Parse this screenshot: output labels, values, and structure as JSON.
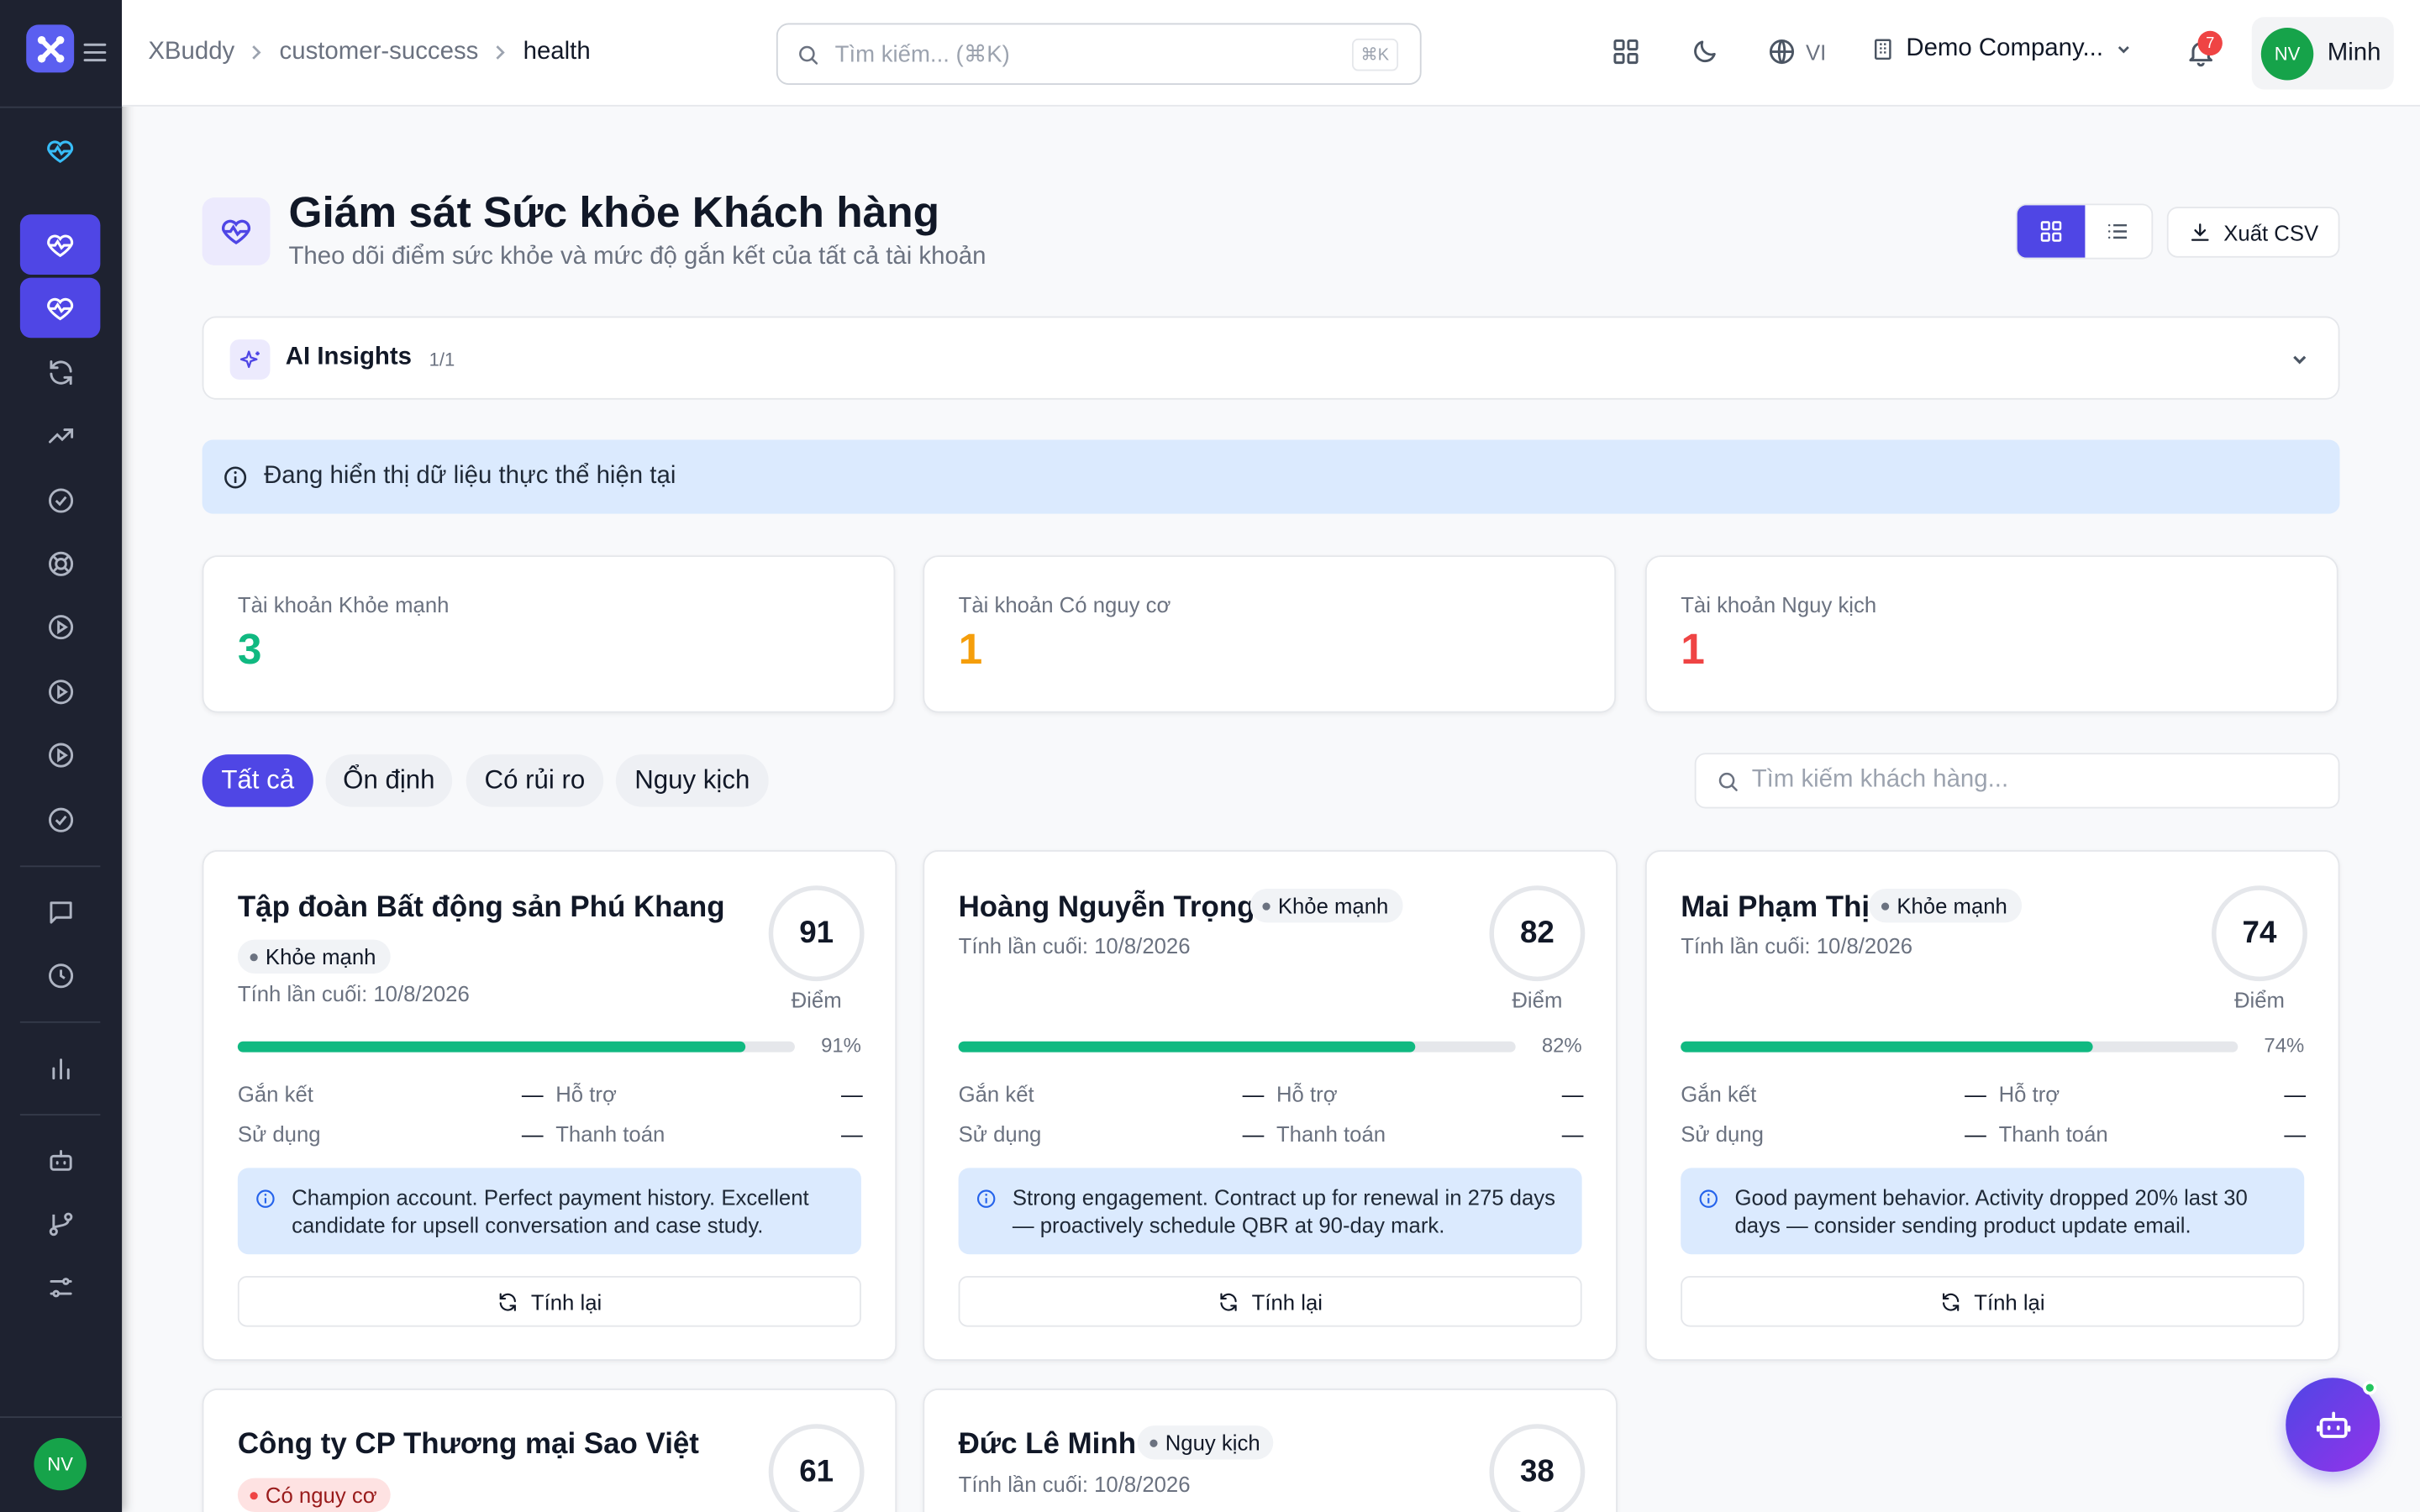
{
  "sidebar": {
    "avatar_initials": "NV"
  },
  "header": {
    "breadcrumb": [
      "XBuddy",
      "customer-success",
      "health"
    ],
    "search_placeholder": "Tìm kiếm... (⌘K)",
    "search_shortcut": "⌘K",
    "language": "VI",
    "company": "Demo Company...",
    "notification_count": "7",
    "user_initials": "NV",
    "user_name": "Minh"
  },
  "page": {
    "title": "Giám sát Sức khỏe Khách hàng",
    "subtitle": "Theo dõi điểm sức khỏe và mức độ gắn kết của tất cả tài khoản",
    "export_label": "Xuất CSV"
  },
  "insights": {
    "title": "AI Insights",
    "count": "1/1"
  },
  "info_banner": "Đang hiển thị dữ liệu thực thể hiện tại",
  "stats": [
    {
      "label": "Tài khoản Khỏe mạnh",
      "value": "3",
      "color": "#10b981"
    },
    {
      "label": "Tài khoản Có nguy cơ",
      "value": "1",
      "color": "#f59e0b"
    },
    {
      "label": "Tài khoản Nguy kịch",
      "value": "1",
      "color": "#ef4444"
    }
  ],
  "filters": {
    "tabs": [
      "Tất cả",
      "Ổn định",
      "Có rủi ro",
      "Nguy kịch"
    ],
    "active": "Tất cả",
    "search_placeholder": "Tìm kiếm khách hàng..."
  },
  "labels": {
    "score_unit": "Điểm",
    "engagement": "Gắn kết",
    "support": "Hỗ trợ",
    "usage": "Sử dụng",
    "payment": "Thanh toán",
    "empty": "—",
    "recalc": "Tính lại"
  },
  "customers": [
    {
      "name": "Tập đoàn Bất động sản Phú Khang",
      "status": "Khỏe mạnh",
      "computed": "Tính lần cuối: 10/8/2026",
      "score": "91",
      "progress": 0.91,
      "percent": "91%",
      "note": "Champion account. Perfect payment history. Excellent candidate for upsell conversation and case study."
    },
    {
      "name": "Hoàng Nguyễn Trọng",
      "status": "Khỏe mạnh",
      "computed": "Tính lần cuối: 10/8/2026",
      "score": "82",
      "progress": 0.82,
      "percent": "82%",
      "note": "Strong engagement. Contract up for renewal in 275 days — proactively schedule QBR at 90-day mark."
    },
    {
      "name": "Mai Phạm Thị",
      "status": "Khỏe mạnh",
      "computed": "Tính lần cuối: 10/8/2026",
      "score": "74",
      "progress": 0.74,
      "percent": "74%",
      "note": "Good payment behavior. Activity dropped 20% last 30 days — consider sending product update email."
    },
    {
      "name": "Công ty CP Thương mại Sao Việt",
      "status": "Có nguy cơ",
      "score": "61"
    },
    {
      "name": "Đức Lê Minh",
      "status": "Nguy kịch",
      "computed": "Tính lần cuối: 10/8/2026",
      "score": "38"
    }
  ]
}
